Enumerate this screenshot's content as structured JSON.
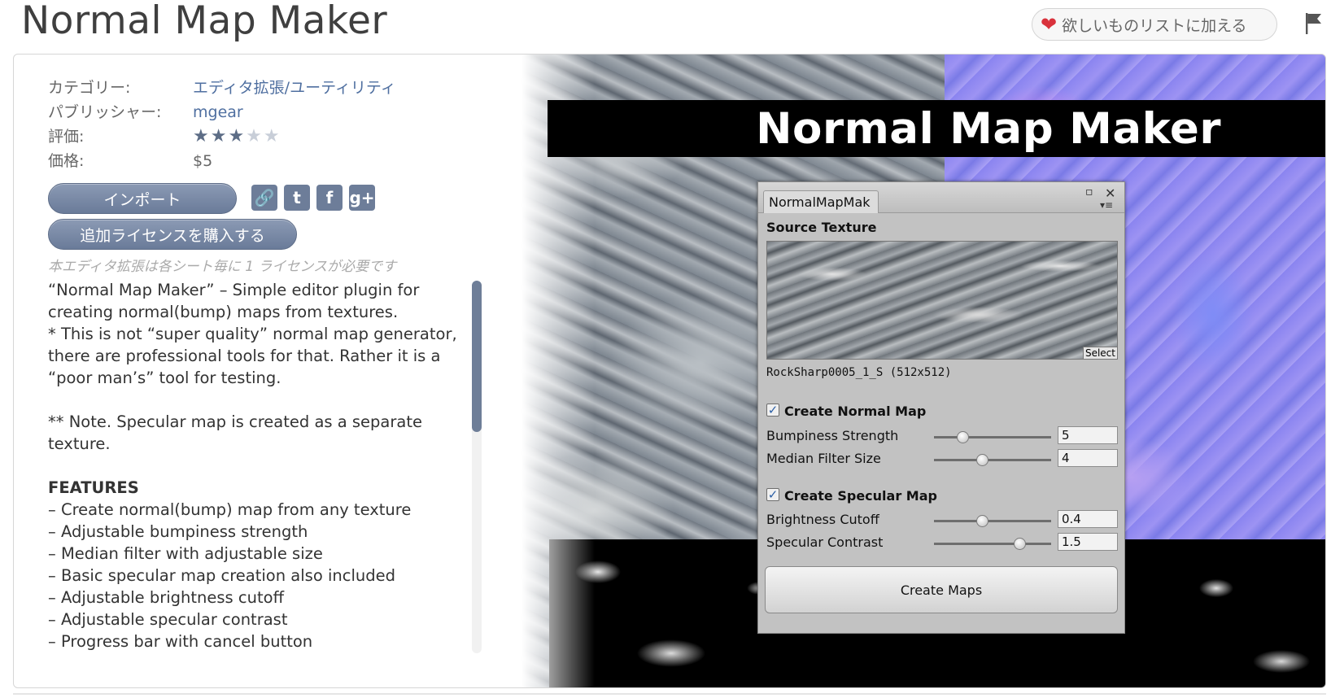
{
  "header": {
    "title": "Normal Map Maker",
    "wishlist_label": "欲しいものリストに加える",
    "wishlist_icon": "heart-icon",
    "flag_icon": "flag-icon"
  },
  "info": {
    "category_label": "カテゴリー:",
    "category_value": "エディタ拡張/ユーティリティ",
    "publisher_label": "パブリッシャー:",
    "publisher_value": "mgear",
    "rating_label": "評価:",
    "rating_stars": "★★★★★",
    "rating_value": 3,
    "rating_max": 5,
    "price_label": "価格:",
    "price_value": "$5"
  },
  "actions": {
    "import_label": "インポート",
    "license_label": "追加ライセンスを購入する",
    "social_icons": [
      "link-icon",
      "twitter-icon",
      "facebook-icon",
      "google-plus-icon"
    ],
    "social_link_glyph": "🔗",
    "social_twitter_glyph": "t",
    "social_facebook_glyph": "f",
    "social_gplus_glyph": "g+"
  },
  "license_note": "本エディタ拡張は各シート毎に 1 ライセンスが必要です",
  "description": {
    "intro": "“Normal Map Maker” – Simple editor plugin for creating normal(bump) maps from textures.\n* This is not “super quality” normal map generator, there are professional tools for that. Rather it is a “poor man’s” tool for testing.",
    "note": "** Note. Specular map is created as a separate texture.",
    "features_heading": "FEATURES",
    "features": [
      "– Create normal(bump) map from any texture",
      "– Adjustable bumpiness strength",
      "– Median filter with adjustable size",
      "– Basic specular map creation also included",
      "– Adjustable brightness cutoff",
      "– Adjustable specular contrast",
      "– Progress bar with cancel button"
    ]
  },
  "promo": {
    "banner_title": "Normal Map Maker",
    "window": {
      "tab_label": "NormalMapMak",
      "max_glyph": "▫",
      "close_glyph": "✕",
      "menu_glyph": "▾≡",
      "source_texture_label": "Source Texture",
      "select_label": "Select",
      "texture_name": "RockSharp0005_1_S (512x512)",
      "create_normal_label": "Create Normal Map",
      "create_normal_checked": true,
      "bumpiness_label": "Bumpiness Strength",
      "bumpiness_value": "5",
      "bumpiness_slider": 0.24,
      "median_label": "Median Filter Size",
      "median_value": "4",
      "median_slider": 0.41,
      "create_specular_label": "Create Specular Map",
      "create_specular_checked": true,
      "brightness_label": "Brightness Cutoff",
      "brightness_value": "0.4",
      "brightness_slider": 0.41,
      "contrast_label": "Specular Contrast",
      "contrast_value": "1.5",
      "contrast_slider": 0.73,
      "check_glyph": "✓",
      "create_button_label": "Create Maps"
    }
  }
}
